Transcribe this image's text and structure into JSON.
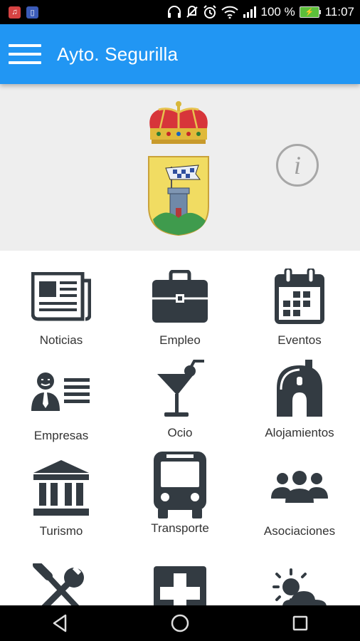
{
  "status_bar": {
    "battery": "100 %",
    "time": "11:07",
    "left_icons": [
      "music-icon",
      "file-icon"
    ],
    "right_icons": [
      "headphones-icon",
      "mute-icon",
      "alarm-icon",
      "wifi-icon",
      "signal-icon",
      "battery-icon"
    ]
  },
  "app_bar": {
    "title": "Ayto. Segurilla",
    "menu_icon": "hamburger-menu-icon"
  },
  "header": {
    "emblem": "coat-of-arms",
    "info_icon": "info-icon"
  },
  "grid": {
    "items": [
      {
        "label": "Noticias",
        "icon": "newspaper-icon"
      },
      {
        "label": "Empleo",
        "icon": "briefcase-icon"
      },
      {
        "label": "Eventos",
        "icon": "calendar-icon"
      },
      {
        "label": "Empresas",
        "icon": "business-person-icon"
      },
      {
        "label": "Ocio",
        "icon": "cocktail-icon"
      },
      {
        "label": "Alojamientos",
        "icon": "house-icon"
      },
      {
        "label": "Turismo",
        "icon": "monument-icon"
      },
      {
        "label": "Transporte",
        "icon": "bus-icon"
      },
      {
        "label": "Asociaciones",
        "icon": "group-icon"
      },
      {
        "label": "",
        "icon": "tools-icon"
      },
      {
        "label": "",
        "icon": "medical-cross-icon"
      },
      {
        "label": "",
        "icon": "weather-icon"
      }
    ]
  },
  "nav_bar": {
    "buttons": [
      "back-icon",
      "home-icon",
      "recents-icon"
    ]
  },
  "colors": {
    "app_bar": "#2196f3",
    "header_bg": "#eeeeee",
    "icon_dark": "#333b42",
    "status_bar": "#000000"
  }
}
